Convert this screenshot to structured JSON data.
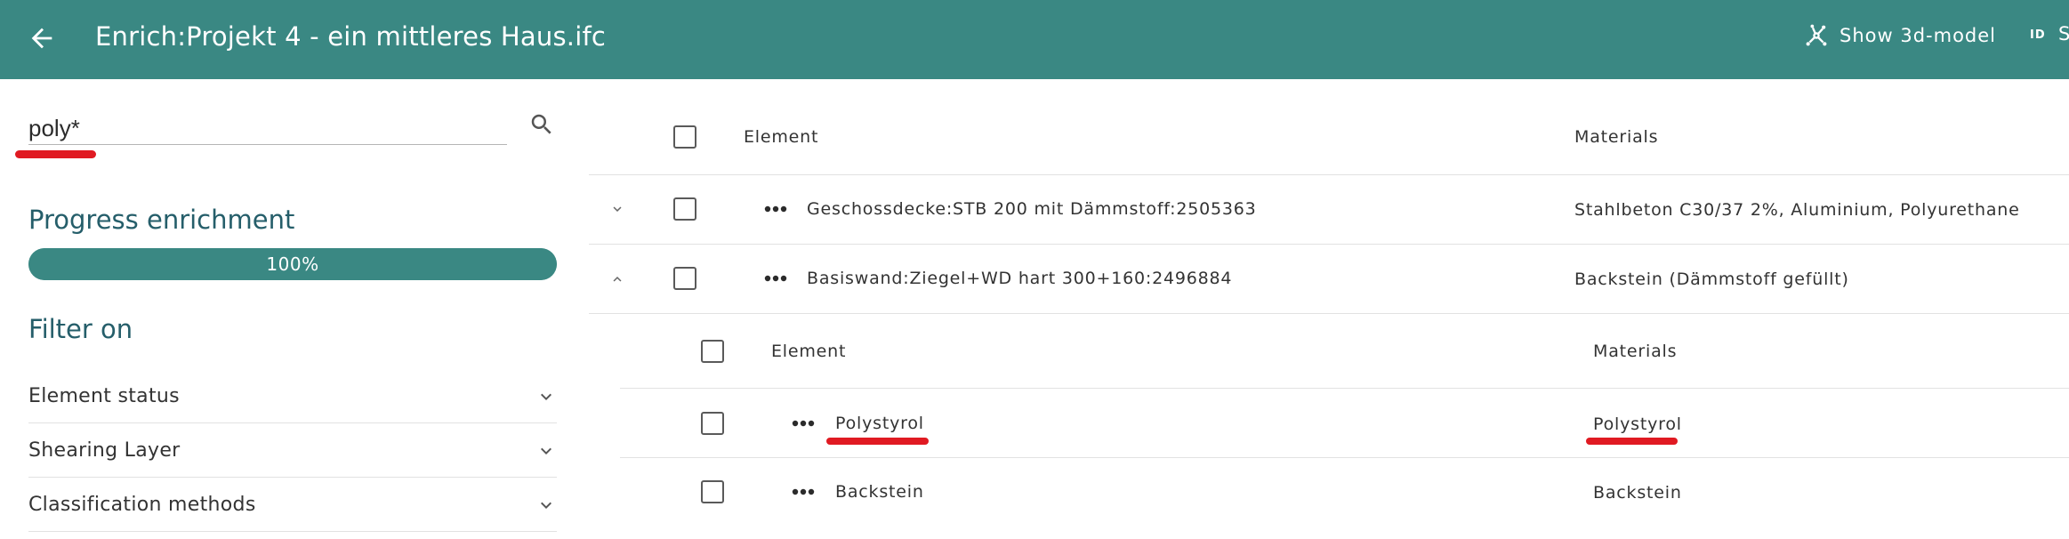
{
  "header": {
    "title": "Enrich:Projekt 4 - ein mittleres Haus.ifc",
    "show_3d_label": "Show 3d-model",
    "id_label": "S"
  },
  "left": {
    "search_value": "poly*",
    "progress_title": "Progress enrichment",
    "progress_value": 1.0,
    "progress_text": "100%",
    "filter_title": "Filter on",
    "filters": [
      {
        "label": "Element status"
      },
      {
        "label": "Shearing Layer"
      },
      {
        "label": "Classification methods"
      }
    ]
  },
  "table": {
    "col_element": "Element",
    "col_materials": "Materials",
    "rows": [
      {
        "element": "Geschossdecke:STB 200 mit Dämmstoff:2505363",
        "materials": "Stahlbeton C30/37 2%, Aluminium, Polyurethane"
      },
      {
        "element": "Basiswand:Ziegel+WD hart 300+160:2496884",
        "materials": "Backstein (Dämmstoff gefüllt)"
      }
    ],
    "subtable": {
      "col_element": "Element",
      "col_materials": "Materials",
      "rows": [
        {
          "element": "Polystyrol",
          "materials": "Polystyrol"
        },
        {
          "element": "Backstein",
          "materials": "Backstein"
        }
      ]
    }
  },
  "colors": {
    "primary": "#3a8883",
    "heading": "#255e6a",
    "highlight": "#e01a22"
  }
}
